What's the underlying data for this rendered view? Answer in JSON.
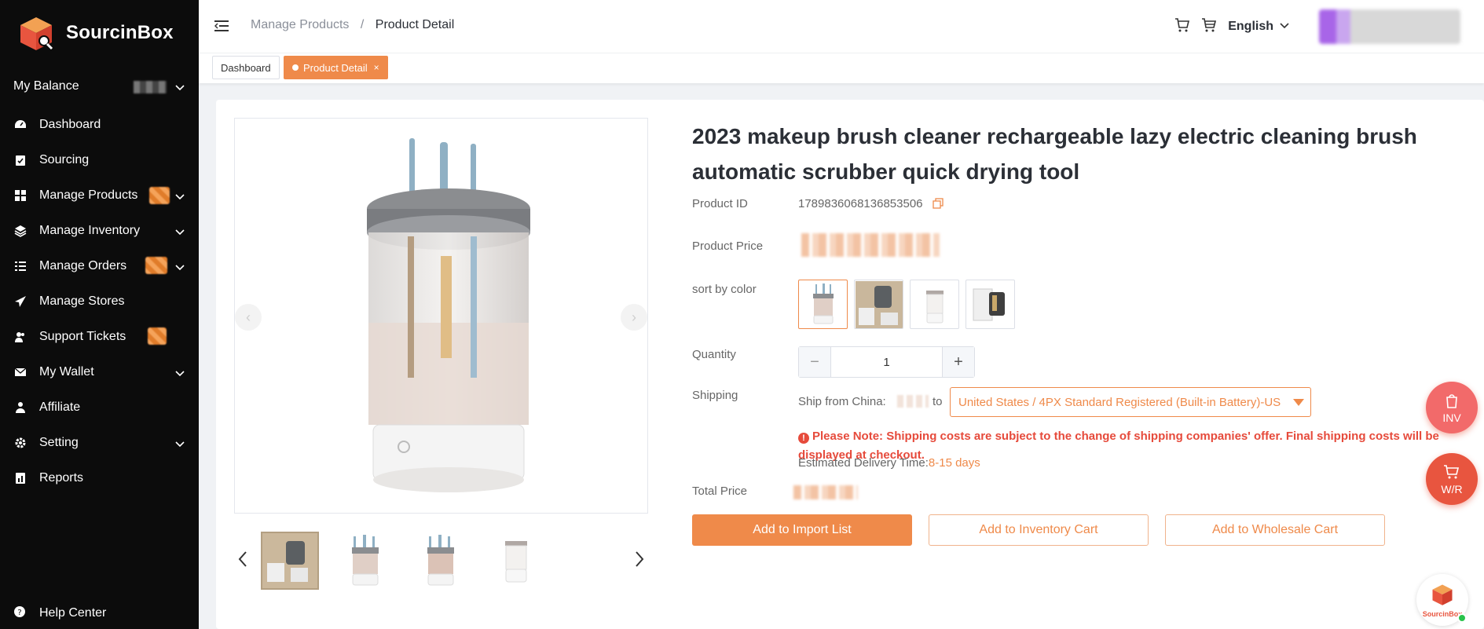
{
  "brand": {
    "name": "SourcinBox",
    "accent": "#ef8a4a"
  },
  "sidebar": {
    "balance_label": "My Balance",
    "items": [
      {
        "label": "Dashboard",
        "icon": "dashboard-icon"
      },
      {
        "label": "Sourcing",
        "icon": "clipboard-check-icon"
      },
      {
        "label": "Manage Products",
        "icon": "grid-icon"
      },
      {
        "label": "Manage Inventory",
        "icon": "layers-icon"
      },
      {
        "label": "Manage Orders",
        "icon": "list-icon"
      },
      {
        "label": "Manage Stores",
        "icon": "paper-plane-icon"
      },
      {
        "label": "Support Tickets",
        "icon": "users-icon"
      },
      {
        "label": "My Wallet",
        "icon": "mail-icon"
      },
      {
        "label": "Affiliate",
        "icon": "person-icon"
      },
      {
        "label": "Setting",
        "icon": "gear-icon"
      },
      {
        "label": "Reports",
        "icon": "report-icon"
      }
    ],
    "help_label": "Help Center"
  },
  "header": {
    "breadcrumb": {
      "parent": "Manage Products",
      "separator": "/",
      "current": "Product Detail"
    },
    "language": "English"
  },
  "tabs": [
    {
      "label": "Dashboard",
      "active": false
    },
    {
      "label": "Product Detail",
      "active": true,
      "close": "×"
    }
  ],
  "product": {
    "title": "2023 makeup brush cleaner rechargeable lazy electric cleaning brush automatic scrubber quick drying tool",
    "id_label": "Product ID",
    "id_value": "1789836068136853506",
    "price_label": "Product Price",
    "color_label": "sort by color",
    "quantity_label": "Quantity",
    "quantity": "1",
    "shipping_label": "Shipping",
    "ship_from": "Ship from China:",
    "ship_to_word": "to",
    "shipping_option": "United States / 4PX Standard Registered (Built-in Battery)-US",
    "note": "Please Note: Shipping costs are subject to the change of shipping companies' offer. Final shipping costs will be displayed at checkout.",
    "eta_label": "Estimated Delivery Time:",
    "eta_value": "8-15 days",
    "total_label": "Total Price"
  },
  "actions": {
    "import": "Add to Import List",
    "inventory": "Add to Inventory Cart",
    "wholesale": "Add to Wholesale Cart"
  },
  "floating": {
    "inv": "INV",
    "wr": "W/R",
    "corner_brand": "SourcinBox"
  }
}
